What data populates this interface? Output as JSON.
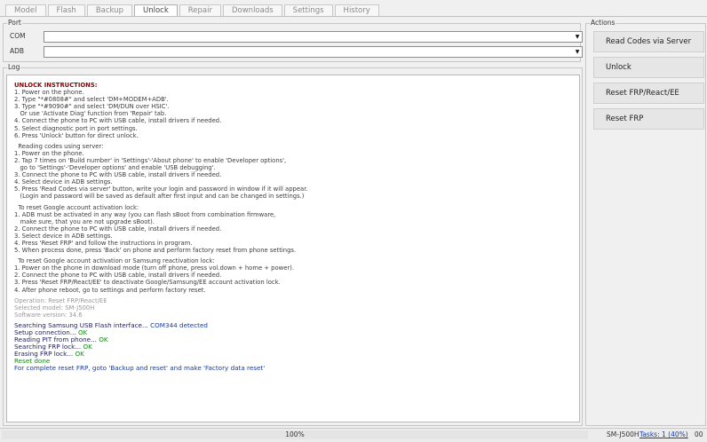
{
  "tabs": [
    "Model",
    "Flash",
    "Backup",
    "Unlock",
    "Repair",
    "Downloads",
    "Settings",
    "History"
  ],
  "active_tab": "Unlock",
  "port": {
    "title": "Port",
    "com_label": "COM",
    "com_value": "",
    "adb_label": "ADB",
    "adb_value": ""
  },
  "log": {
    "title": "Log",
    "lines": [
      {
        "t": "UNLOCK INSTRUCTIONS:",
        "c": "head"
      },
      {
        "t": "1. Power on the phone."
      },
      {
        "t": "2. Type \"*#0808#\" and select 'DM+MODEM+ADB'."
      },
      {
        "t": "3. Type \"*#9090#\" and select 'DM/DUN over HSIC'."
      },
      {
        "t": "   Or use 'Activate Diag' function from 'Repair' tab."
      },
      {
        "t": "4. Connect the phone to PC with USB cable, install drivers if needed."
      },
      {
        "t": "5. Select diagnostic port in port settings."
      },
      {
        "t": "6. Press 'Unlock' button for direct unlock."
      },
      {
        "t": "",
        "c": "blank"
      },
      {
        "t": "  Reading codes using server:"
      },
      {
        "t": "1. Power on the phone."
      },
      {
        "t": "2. Tap 7 times on 'Build number' in 'Settings'-'About phone' to enable 'Developer options',"
      },
      {
        "t": "   go to 'Settings'-'Developer options' and enable 'USB debugging'."
      },
      {
        "t": "3. Connect the phone to PC with USB cable, install drivers if needed."
      },
      {
        "t": "4. Select device in ADB settings."
      },
      {
        "t": "5. Press 'Read Codes via server' button, write your login and password in window if it will appear."
      },
      {
        "t": "   (Login and password will be saved as default after first input and can be changed in settings.)"
      },
      {
        "t": "",
        "c": "blank"
      },
      {
        "t": "  To reset Google account activation lock:"
      },
      {
        "t": "1. ADB must be activated in any way (you can flash sBoot from combination firmware,"
      },
      {
        "t": "   make sure, that you are not upgrade sBoot)."
      },
      {
        "t": "2. Connect the phone to PC with USB cable, install drivers if needed."
      },
      {
        "t": "3. Select device in ADB settings."
      },
      {
        "t": "4. Press 'Reset FRP' and follow the instructions in program."
      },
      {
        "t": "5. When process done, press 'Back' on phone and perform factory reset from phone settings."
      },
      {
        "t": "",
        "c": "blank"
      },
      {
        "t": "  To reset Google account activation or Samsung reactivation lock:"
      },
      {
        "t": "1. Power on the phone in download mode (turn off phone, press vol.down + home + power)."
      },
      {
        "t": "2. Connect the phone to PC with USB cable, install drivers if needed."
      },
      {
        "t": "3. Press 'Reset FRP/React/EE' to deactivate Google/Samsung/EE account activation lock."
      },
      {
        "t": "4. After phone reboot, go to settings and perform factory reset."
      },
      {
        "t": "",
        "c": "blank"
      },
      {
        "t": "Operation: Reset FRP/React/EE",
        "c": "gray"
      },
      {
        "t": "Selected model: SM-J500H",
        "c": "gray"
      },
      {
        "t": "Software version: 34.6",
        "c": "gray"
      },
      {
        "t": "",
        "c": "blank"
      }
    ],
    "status": [
      {
        "a": "Searching Samsung USB Flash interface... ",
        "b": "COM344 detected",
        "bc": "hl"
      },
      {
        "a": "Setup connection... ",
        "b": "OK",
        "bc": "ok"
      },
      {
        "a": "Reading PIT from phone... ",
        "b": "OK",
        "bc": "ok"
      },
      {
        "a": "Searching FRP lock... ",
        "b": "OK",
        "bc": "ok"
      },
      {
        "a": "Erasing FRP lock... ",
        "b": "OK",
        "bc": "ok"
      },
      {
        "a": "Reset done",
        "b": "",
        "ac": "green"
      },
      {
        "a": "For complete reset FRP, goto 'Backup and reset' and make 'Factory data reset'",
        "b": "",
        "ac": "blue"
      }
    ]
  },
  "actions": {
    "title": "Actions",
    "buttons": [
      "Read Codes via Server",
      "Unlock",
      "Reset FRP/React/EE",
      "Reset FRP"
    ]
  },
  "statusbar": {
    "progress_text": "100%",
    "progress": 1.0,
    "model": "SM-J500H",
    "tasks": "Tasks: 1 (40%)",
    "time": "00"
  }
}
